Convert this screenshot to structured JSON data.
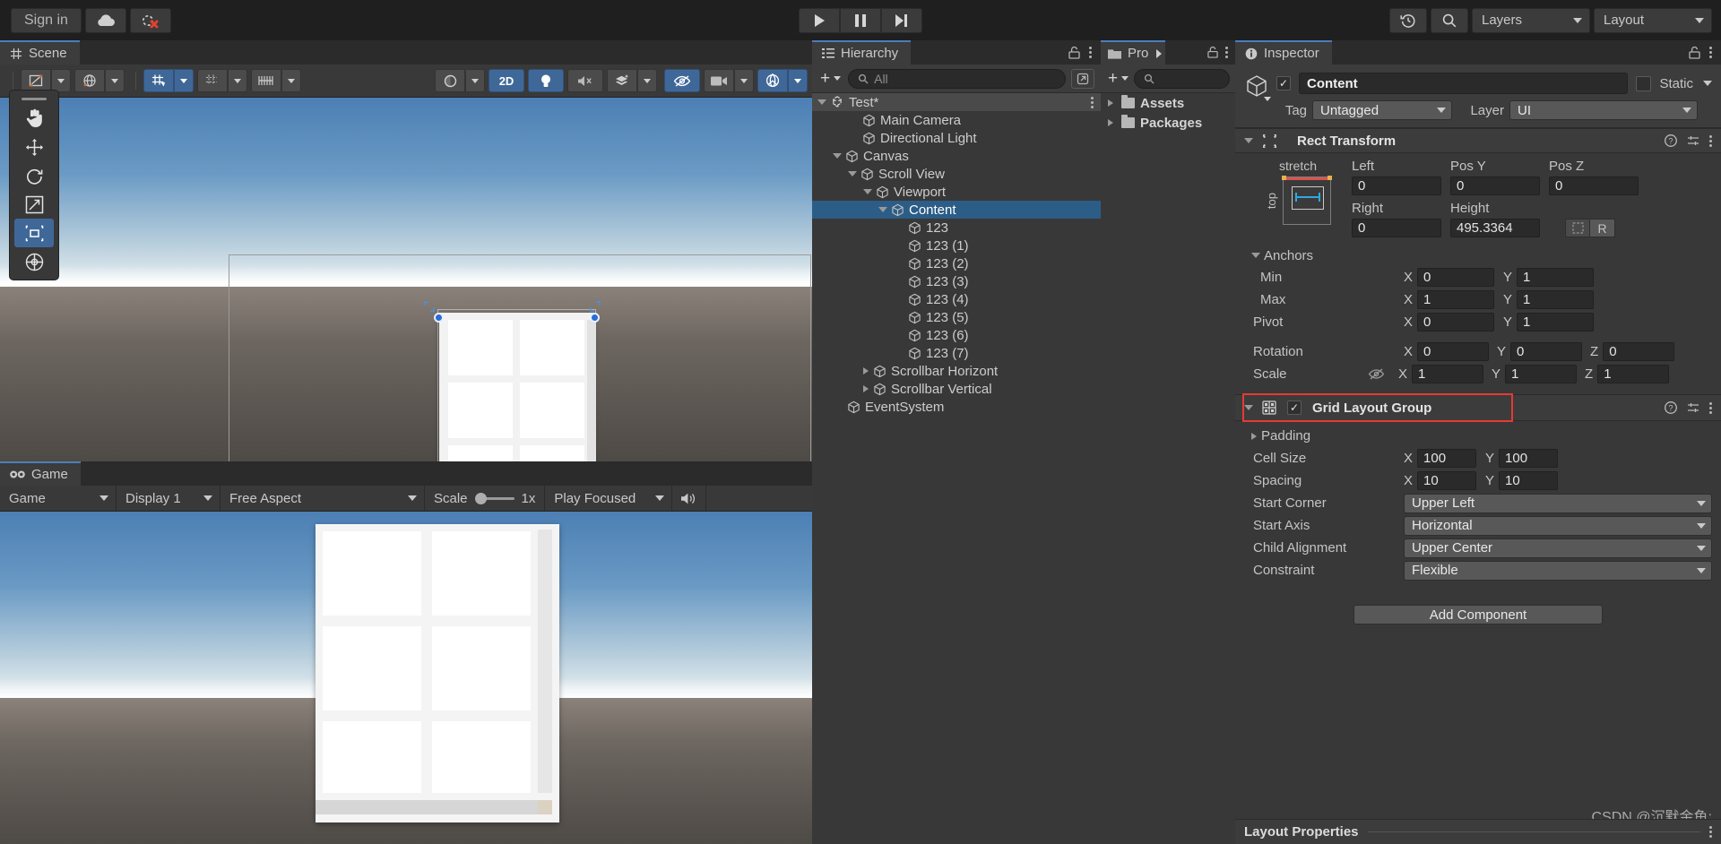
{
  "topbar": {
    "signin_label": "Sign in",
    "cloud_icon": "cloud-icon",
    "collab_icon": "collab-error-icon",
    "play_icon": "play-icon",
    "pause_icon": "pause-icon",
    "step_icon": "step-icon",
    "history_icon": "undo-history-icon",
    "search_icon": "search-icon",
    "layers_label": "Layers",
    "layout_label": "Layout"
  },
  "scene": {
    "tab_label": "Scene",
    "tab_icon": "grid-icon",
    "toolbar": {
      "tool_draw": "draw-tool-icon",
      "global_icon": "global-handle-icon",
      "grid_icon": "grid-snap-icon",
      "grid_visibility_icon": "grid-visibility-icon",
      "ruler_icon": "ruler-icon",
      "gizmo_icon": "gizmos-sphere-icon",
      "twod_label": "2D",
      "light_icon": "lighting-icon",
      "audio_icon": "audio-mute-icon",
      "fx_icon": "effects-icon",
      "hidden_icon": "scene-visibility-icon",
      "camera_icon": "camera-icon",
      "gizmo_toggle_icon": "gizmos-toggle-icon"
    },
    "tools": [
      {
        "name": "hand-tool",
        "icon": "hand-icon"
      },
      {
        "name": "move-tool",
        "icon": "move-icon"
      },
      {
        "name": "rotate-tool",
        "icon": "rotate-icon"
      },
      {
        "name": "scale-tool",
        "icon": "scale-icon"
      },
      {
        "name": "rect-tool",
        "icon": "rect-icon",
        "active": true
      },
      {
        "name": "transform-tool",
        "icon": "transform-icon"
      }
    ]
  },
  "game": {
    "tab_label": "Game",
    "tab_icon": "game-icon",
    "target_display_label": "Game",
    "display_label": "Display 1",
    "aspect_label": "Free Aspect",
    "scale_label": "Scale",
    "scale_value": "1x",
    "play_mode_label": "Play Focused",
    "mute_icon": "audio-icon"
  },
  "hierarchy": {
    "tab_label": "Hierarchy",
    "tab_icon": "hierarchy-icon",
    "lock_icon": "lock-icon",
    "menu_icon": "kebab-icon",
    "add_label": "+",
    "search_placeholder": "All",
    "search_icon": "search-icon",
    "expand_icon": "open-in-new-icon",
    "items": [
      {
        "label": "Test*",
        "depth": 0,
        "expand": "open",
        "icon": "unity-scene-icon",
        "selected": false,
        "root": true
      },
      {
        "label": "Main Camera",
        "depth": 2,
        "expand": "none",
        "icon": "gameobject-icon",
        "selected": false
      },
      {
        "label": "Directional Light",
        "depth": 2,
        "expand": "none",
        "icon": "gameobject-icon",
        "selected": false
      },
      {
        "label": "Canvas",
        "depth": 1,
        "expand": "open",
        "icon": "gameobject-icon",
        "selected": false
      },
      {
        "label": "Scroll View",
        "depth": 2,
        "expand": "open",
        "icon": "gameobject-icon",
        "selected": false
      },
      {
        "label": "Viewport",
        "depth": 3,
        "expand": "open",
        "icon": "gameobject-icon",
        "selected": false
      },
      {
        "label": "Content",
        "depth": 4,
        "expand": "open",
        "icon": "gameobject-icon",
        "selected": true
      },
      {
        "label": "123",
        "depth": 5,
        "expand": "none",
        "icon": "gameobject-icon",
        "selected": false
      },
      {
        "label": "123 (1)",
        "depth": 5,
        "expand": "none",
        "icon": "gameobject-icon",
        "selected": false
      },
      {
        "label": "123 (2)",
        "depth": 5,
        "expand": "none",
        "icon": "gameobject-icon",
        "selected": false
      },
      {
        "label": "123 (3)",
        "depth": 5,
        "expand": "none",
        "icon": "gameobject-icon",
        "selected": false
      },
      {
        "label": "123 (4)",
        "depth": 5,
        "expand": "none",
        "icon": "gameobject-icon",
        "selected": false
      },
      {
        "label": "123 (5)",
        "depth": 5,
        "expand": "none",
        "icon": "gameobject-icon",
        "selected": false
      },
      {
        "label": "123 (6)",
        "depth": 5,
        "expand": "none",
        "icon": "gameobject-icon",
        "selected": false
      },
      {
        "label": "123 (7)",
        "depth": 5,
        "expand": "none",
        "icon": "gameobject-icon",
        "selected": false
      },
      {
        "label": "Scrollbar Horizont",
        "depth": 3,
        "expand": "closed",
        "icon": "gameobject-icon",
        "selected": false
      },
      {
        "label": "Scrollbar Vertical",
        "depth": 3,
        "expand": "closed",
        "icon": "gameobject-icon",
        "selected": false
      },
      {
        "label": "EventSystem",
        "depth": 1,
        "expand": "none",
        "icon": "gameobject-icon",
        "selected": false
      }
    ]
  },
  "project": {
    "tab_label": "Pro",
    "tab_icon": "folder-icon",
    "overflow_icon": "chevron-right-icon",
    "lock_icon": "lock-icon",
    "menu_icon": "kebab-icon",
    "add_label": "+",
    "search_icon": "search-icon",
    "items": [
      {
        "label": "Assets"
      },
      {
        "label": "Packages"
      }
    ]
  },
  "inspector": {
    "tab_label": "Inspector",
    "tab_icon": "info-icon",
    "lock_icon": "lock-icon",
    "menu_icon": "kebab-icon",
    "object": {
      "enabled": true,
      "name": "Content",
      "static_label": "Static",
      "static_checked": false,
      "tag_label": "Tag",
      "tag_value": "Untagged",
      "layer_label": "Layer",
      "layer_value": "UI"
    },
    "rect_transform": {
      "title": "Rect Transform",
      "icon": "rect-transform-icon",
      "help_icon": "help-icon",
      "preset_icon": "preset-icon",
      "menu_icon": "kebab-icon",
      "anchor_preset_label": "stretch",
      "anchor_side_label": "top",
      "fields": [
        {
          "label": "Left",
          "value": "0"
        },
        {
          "label": "Pos Y",
          "value": "0"
        },
        {
          "label": "Pos Z",
          "value": "0"
        },
        {
          "label": "Right",
          "value": "0"
        },
        {
          "label": "Height",
          "value": "495.3364"
        }
      ],
      "blueprint_icon": "blueprint-icon",
      "raw_label": "R",
      "anchors_label": "Anchors",
      "min_label": "Min",
      "min_x": "0",
      "min_y": "1",
      "max_label": "Max",
      "max_x": "1",
      "max_y": "1",
      "pivot_label": "Pivot",
      "pivot_x": "0",
      "pivot_y": "1",
      "rotation_label": "Rotation",
      "rot_x": "0",
      "rot_y": "0",
      "rot_z": "0",
      "scale_label": "Scale",
      "scale_link_icon": "constrained-proportions-off-icon",
      "scale_x": "1",
      "scale_y": "1",
      "scale_z": "1"
    },
    "grid_layout_group": {
      "title": "Grid Layout Group",
      "icon": "grid-layout-icon",
      "enabled": true,
      "highlighted": true,
      "highlight_color": "#e53935",
      "help_icon": "help-icon",
      "preset_icon": "preset-icon",
      "menu_icon": "kebab-icon",
      "padding_label": "Padding",
      "cell_size_label": "Cell Size",
      "cell_x": "100",
      "cell_y": "100",
      "spacing_label": "Spacing",
      "spacing_x": "10",
      "spacing_y": "10",
      "start_corner_label": "Start Corner",
      "start_corner_value": "Upper Left",
      "start_axis_label": "Start Axis",
      "start_axis_value": "Horizontal",
      "child_alignment_label": "Child Alignment",
      "child_alignment_value": "Upper Center",
      "constraint_label": "Constraint",
      "constraint_value": "Flexible"
    },
    "add_component_label": "Add Component",
    "layout_properties_label": "Layout Properties"
  },
  "watermark": "CSDN @沉默金鱼:"
}
